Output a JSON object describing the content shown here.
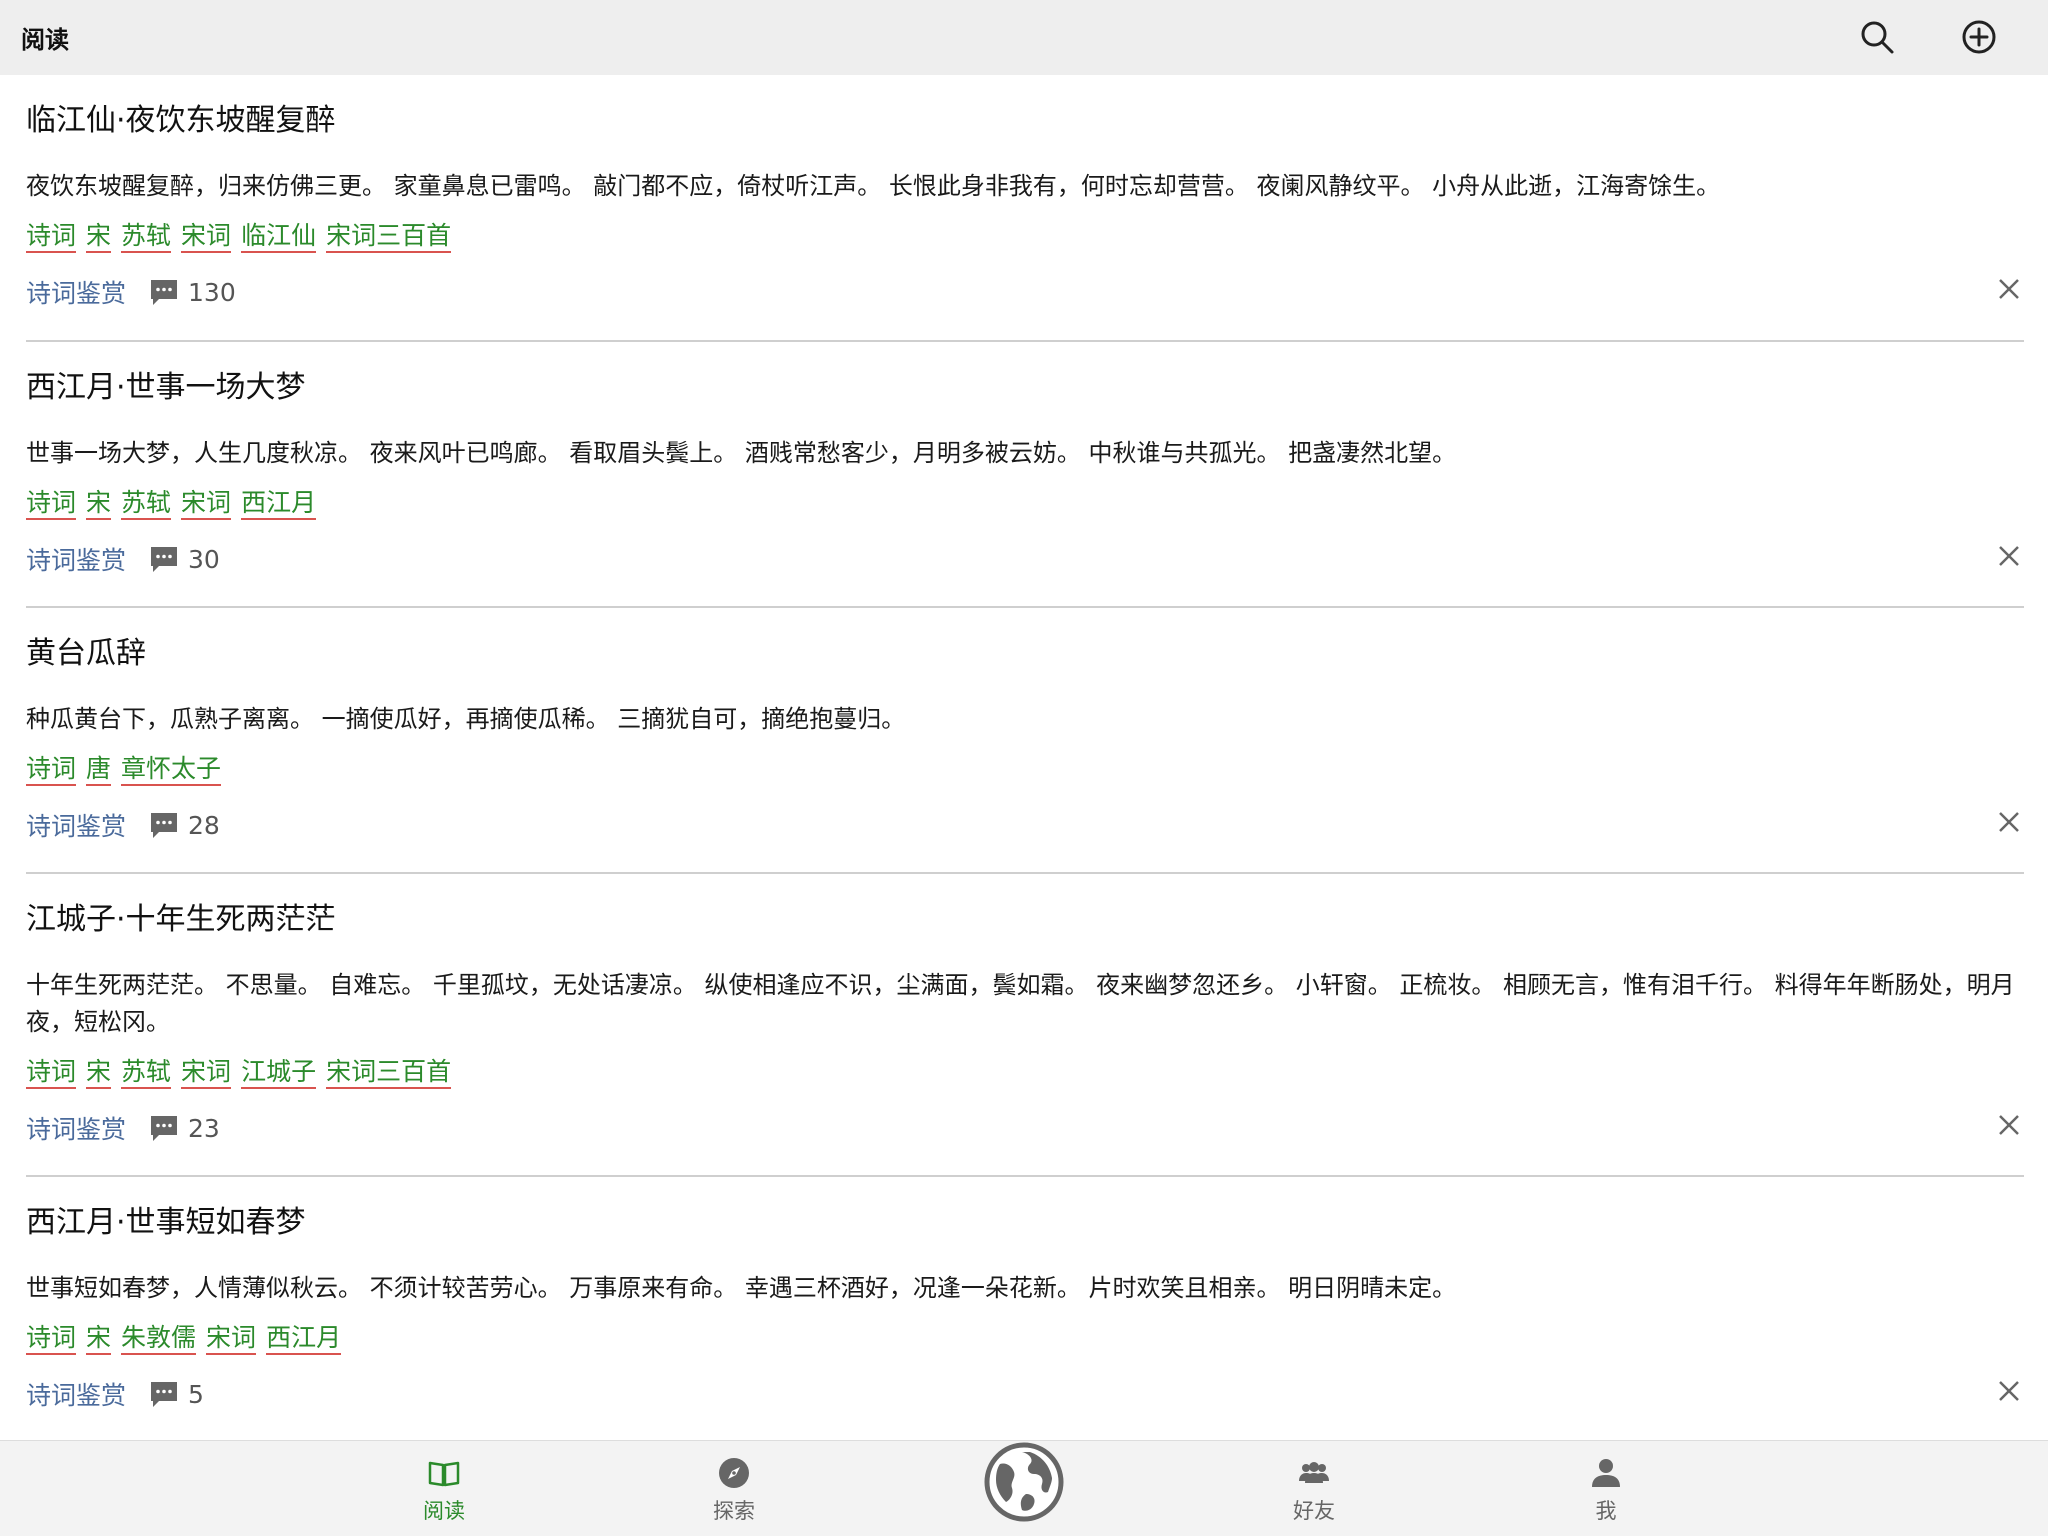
{
  "header": {
    "title": "阅读"
  },
  "poems": [
    {
      "title": "临江仙·夜饮东坡醒复醉",
      "text": "夜饮东坡醒复醉，归来仿佛三更。 家童鼻息已雷鸣。 敲门都不应，倚杖听江声。 长恨此身非我有，何时忘却营营。 夜阑风静纹平。 小舟从此逝，江海寄馀生。",
      "tags": [
        "诗词",
        "宋",
        "苏轼",
        "宋词",
        "临江仙",
        "宋词三百首"
      ],
      "appreciation": "诗词鉴赏",
      "comments": "130"
    },
    {
      "title": "西江月·世事一场大梦",
      "text": "世事一场大梦，人生几度秋凉。 夜来风叶已鸣廊。 看取眉头鬓上。 酒贱常愁客少，月明多被云妨。 中秋谁与共孤光。 把盏凄然北望。",
      "tags": [
        "诗词",
        "宋",
        "苏轼",
        "宋词",
        "西江月"
      ],
      "appreciation": "诗词鉴赏",
      "comments": "30"
    },
    {
      "title": "黄台瓜辞",
      "text": "种瓜黄台下，瓜熟子离离。 一摘使瓜好，再摘使瓜稀。 三摘犹自可，摘绝抱蔓归。",
      "tags": [
        "诗词",
        "唐",
        "章怀太子"
      ],
      "appreciation": "诗词鉴赏",
      "comments": "28"
    },
    {
      "title": "江城子·十年生死两茫茫",
      "text": "十年生死两茫茫。 不思量。 自难忘。 千里孤坟，无处话凄凉。 纵使相逢应不识，尘满面，鬓如霜。 夜来幽梦忽还乡。 小轩窗。 正梳妆。 相顾无言，惟有泪千行。 料得年年断肠处，明月夜，短松冈。",
      "tags": [
        "诗词",
        "宋",
        "苏轼",
        "宋词",
        "江城子",
        "宋词三百首"
      ],
      "appreciation": "诗词鉴赏",
      "comments": "23"
    },
    {
      "title": "西江月·世事短如春梦",
      "text": "世事短如春梦，人情薄似秋云。 不须计较苦劳心。 万事原来有命。 幸遇三杯酒好，况逢一朵花新。 片时欢笑且相亲。 明日阴晴未定。",
      "tags": [
        "诗词",
        "宋",
        "朱敦儒",
        "宋词",
        "西江月"
      ],
      "appreciation": "诗词鉴赏",
      "comments": "5"
    }
  ],
  "tabbar": {
    "read": "阅读",
    "explore": "探索",
    "friends": "好友",
    "me": "我"
  },
  "colors": {
    "accent_green": "#2b8a2b",
    "tag_underline": "#d9534f",
    "appreciation_blue": "#4a6a9b"
  }
}
